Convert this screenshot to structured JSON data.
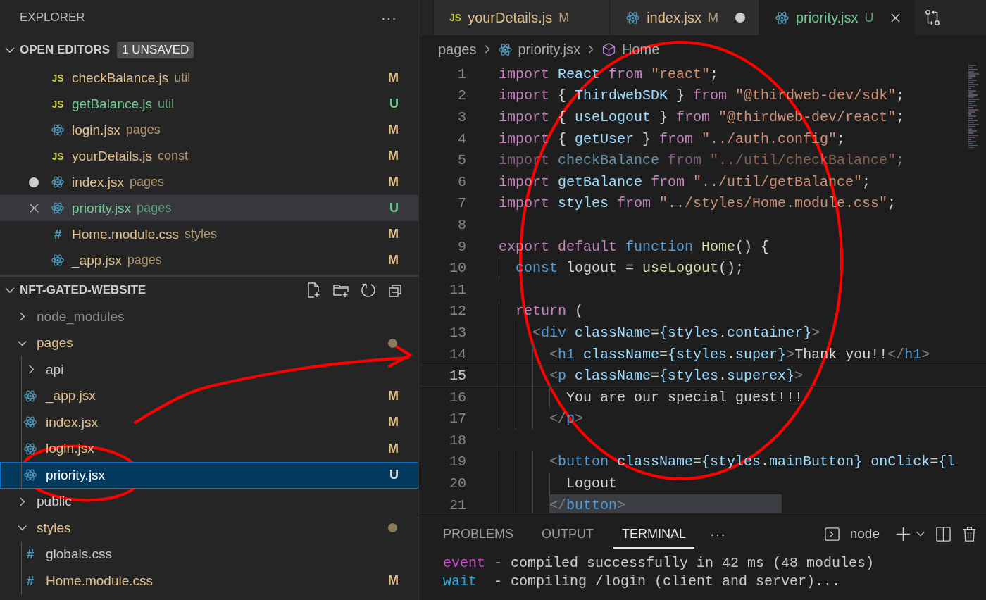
{
  "explorer": {
    "title": "EXPLORER",
    "more": "···"
  },
  "open_editors": {
    "title": "OPEN EDITORS",
    "badge": "1 UNSAVED",
    "expanded": true,
    "items": [
      {
        "kind": "js",
        "glyph": "JS",
        "name": "checkBalance.js",
        "folder": "util",
        "color": "#e2c08d",
        "status": "M",
        "unsaved": false,
        "hovered": false,
        "selected": false
      },
      {
        "kind": "js",
        "glyph": "JS",
        "name": "getBalance.js",
        "folder": "util",
        "color": "#73c991",
        "status": "U",
        "unsaved": false,
        "hovered": false,
        "selected": false
      },
      {
        "kind": "react",
        "name": "login.jsx",
        "folder": "pages",
        "color": "#e2c08d",
        "status": "M",
        "unsaved": false,
        "hovered": false,
        "selected": false
      },
      {
        "kind": "js",
        "glyph": "JS",
        "name": "yourDetails.js",
        "folder": "const",
        "color": "#e2c08d",
        "status": "M",
        "unsaved": false,
        "hovered": false,
        "selected": false
      },
      {
        "kind": "react",
        "name": "index.jsx",
        "folder": "pages",
        "color": "#e2c08d",
        "status": "M",
        "unsaved": true,
        "hovered": false,
        "selected": false
      },
      {
        "kind": "react",
        "name": "priority.jsx",
        "folder": "pages",
        "color": "#73c991",
        "status": "U",
        "unsaved": false,
        "hovered": true,
        "selected": true
      },
      {
        "kind": "css",
        "glyph": "#",
        "name": "Home.module.css",
        "folder": "styles",
        "color": "#e2c08d",
        "status": "M",
        "unsaved": false,
        "hovered": false,
        "selected": false
      },
      {
        "kind": "react",
        "name": "_app.jsx",
        "folder": "pages",
        "color": "#e2c08d",
        "status": "M",
        "unsaved": false,
        "hovered": false,
        "selected": false
      }
    ]
  },
  "project": {
    "title": "NFT-GATED-WEBSITE",
    "expanded": true,
    "tree": [
      {
        "name": "node_modules",
        "kind": "folder",
        "expanded": false,
        "color": "#8c8c8c",
        "changed": false,
        "selected": false
      },
      {
        "name": "pages",
        "kind": "folder",
        "expanded": true,
        "color": "#e2c08d",
        "changed": true,
        "selected": false,
        "children": [
          {
            "name": "api",
            "kind": "folder",
            "expanded": false,
            "color": "#cccccc",
            "changed": false,
            "selected": false
          },
          {
            "name": "_app.jsx",
            "kind": "react",
            "color": "#e2c08d",
            "status": "M",
            "selected": false
          },
          {
            "name": "index.jsx",
            "kind": "react",
            "color": "#e2c08d",
            "status": "M",
            "selected": false
          },
          {
            "name": "login.jsx",
            "kind": "react",
            "color": "#e2c08d",
            "status": "M",
            "selected": false
          },
          {
            "name": "priority.jsx",
            "kind": "react",
            "status": "U",
            "selected": true
          }
        ]
      },
      {
        "name": "public",
        "kind": "folder",
        "expanded": false,
        "color": "#cccccc",
        "changed": false,
        "selected": false
      },
      {
        "name": "styles",
        "kind": "folder",
        "expanded": true,
        "color": "#e2c08d",
        "changed": true,
        "selected": false,
        "children": [
          {
            "name": "globals.css",
            "kind": "css",
            "glyph": "#",
            "color": "#cccccc",
            "selected": false
          },
          {
            "name": "Home.module.css",
            "kind": "css",
            "glyph": "#",
            "color": "#e2c08d",
            "status": "M",
            "selected": false
          }
        ]
      }
    ]
  },
  "tabs": [
    {
      "kind": "js",
      "glyph": "JS",
      "name": "yourDetails.js",
      "color": "#e2c08d",
      "status": "M",
      "unsaved": false,
      "selected": false
    },
    {
      "kind": "react",
      "name": "index.jsx",
      "color": "#e2c08d",
      "status": "M",
      "unsaved": true,
      "selected": false
    },
    {
      "kind": "react",
      "name": "priority.jsx",
      "color": "#73c991",
      "status": "U",
      "unsaved": false,
      "selected": true
    }
  ],
  "breadcrumb": [
    {
      "label": "pages",
      "kind": "folder"
    },
    {
      "label": "priority.jsx",
      "kind": "react"
    },
    {
      "label": "Home",
      "kind": "symbol"
    }
  ],
  "code": [
    {
      "number": "1",
      "tokens": [
        {
          "kind": "kw",
          "text": "import"
        },
        {
          "kind": "var",
          "text": " React "
        },
        {
          "kind": "kw",
          "text": "from "
        },
        {
          "kind": "str",
          "text": "\"react\""
        },
        {
          "kind": "punc",
          "text": ";"
        }
      ]
    },
    {
      "number": "2",
      "tokens": [
        {
          "kind": "kw",
          "text": "import "
        },
        {
          "kind": "punc",
          "text": "{ "
        },
        {
          "kind": "var",
          "text": "ThirdwebSDK"
        },
        {
          "kind": "punc",
          "text": " } "
        },
        {
          "kind": "kw",
          "text": "from "
        },
        {
          "kind": "str",
          "text": "\"@thirdweb-dev/sdk\""
        },
        {
          "kind": "punc",
          "text": ";"
        }
      ]
    },
    {
      "number": "3",
      "tokens": [
        {
          "kind": "kw",
          "text": "import "
        },
        {
          "kind": "punc",
          "text": "{ "
        },
        {
          "kind": "var",
          "text": "useLogout"
        },
        {
          "kind": "punc",
          "text": " } "
        },
        {
          "kind": "kw",
          "text": "from "
        },
        {
          "kind": "str",
          "text": "\"@thirdweb-dev/react\""
        },
        {
          "kind": "punc",
          "text": ";"
        }
      ]
    },
    {
      "number": "4",
      "tokens": [
        {
          "kind": "kw",
          "text": "import "
        },
        {
          "kind": "punc",
          "text": "{ "
        },
        {
          "kind": "var",
          "text": "getUser"
        },
        {
          "kind": "punc",
          "text": " } "
        },
        {
          "kind": "kw",
          "text": "from "
        },
        {
          "kind": "str",
          "text": "\"../auth.config\""
        },
        {
          "kind": "punc",
          "text": ";"
        }
      ]
    },
    {
      "number": "5",
      "faded": true,
      "tokens": [
        {
          "kind": "kw",
          "text": "import"
        },
        {
          "kind": "var",
          "text": " checkBalance "
        },
        {
          "kind": "kw",
          "text": "from "
        },
        {
          "kind": "str",
          "text": "\"../util/checkBalance\""
        },
        {
          "kind": "punc",
          "text": ";"
        }
      ]
    },
    {
      "number": "6",
      "tokens": [
        {
          "kind": "kw",
          "text": "import"
        },
        {
          "kind": "var",
          "text": " getBalance "
        },
        {
          "kind": "kw",
          "text": "from "
        },
        {
          "kind": "str",
          "text": "\"../util/getBalance\""
        },
        {
          "kind": "punc",
          "text": ";"
        }
      ]
    },
    {
      "number": "7",
      "tokens": [
        {
          "kind": "kw",
          "text": "import"
        },
        {
          "kind": "var",
          "text": " styles "
        },
        {
          "kind": "kw",
          "text": "from "
        },
        {
          "kind": "str",
          "text": "\"../styles/Home.module.css\""
        },
        {
          "kind": "punc",
          "text": ";"
        }
      ]
    },
    {
      "number": "8"
    },
    {
      "number": "9",
      "tokens": [
        {
          "kind": "kw",
          "text": "export default "
        },
        {
          "kind": "storage",
          "text": "function "
        },
        {
          "kind": "fn",
          "text": "Home"
        },
        {
          "kind": "punc",
          "text": "() {"
        }
      ]
    },
    {
      "number": "10",
      "tokens": [
        {
          "kind": "storage",
          "text": "  const "
        },
        {
          "kind": "punc",
          "text": "logout = "
        },
        {
          "kind": "fn",
          "text": "useLogout"
        },
        {
          "kind": "punc",
          "text": "();"
        }
      ]
    },
    {
      "number": "11"
    },
    {
      "number": "12",
      "tokens": [
        {
          "kind": "kw",
          "text": "  return "
        },
        {
          "kind": "punc",
          "text": "("
        }
      ]
    },
    {
      "number": "13",
      "tokens": [
        {
          "kind": "bracket",
          "text": "    <"
        },
        {
          "kind": "tag",
          "text": "div "
        },
        {
          "kind": "attr",
          "text": "className"
        },
        {
          "kind": "punc",
          "text": "="
        },
        {
          "kind": "var",
          "text": "{styles"
        },
        {
          "kind": "punc",
          "text": "."
        },
        {
          "kind": "var",
          "text": "container}"
        },
        {
          "kind": "bracket",
          "text": ">"
        }
      ]
    },
    {
      "number": "14",
      "tokens": [
        {
          "kind": "bracket",
          "text": "      <"
        },
        {
          "kind": "tag",
          "text": "h1 "
        },
        {
          "kind": "attr",
          "text": "className"
        },
        {
          "kind": "punc",
          "text": "="
        },
        {
          "kind": "var",
          "text": "{styles"
        },
        {
          "kind": "punc",
          "text": "."
        },
        {
          "kind": "var",
          "text": "super}"
        },
        {
          "kind": "bracket",
          "text": ">"
        },
        {
          "kind": "punc",
          "text": "Thank you!!"
        },
        {
          "kind": "bracket",
          "text": "</"
        },
        {
          "kind": "tag",
          "text": "h1"
        },
        {
          "kind": "bracket",
          "text": ">"
        }
      ]
    },
    {
      "number": "15",
      "current": true,
      "tokens": [
        {
          "kind": "bracket",
          "text": "      <"
        },
        {
          "kind": "tag",
          "text": "p "
        },
        {
          "kind": "attr",
          "text": "className"
        },
        {
          "kind": "punc",
          "text": "="
        },
        {
          "kind": "var",
          "text": "{styles"
        },
        {
          "kind": "punc",
          "text": "."
        },
        {
          "kind": "var",
          "text": "superex}"
        },
        {
          "kind": "bracket",
          "text": ">"
        }
      ]
    },
    {
      "number": "16",
      "tokens": [
        {
          "kind": "punc",
          "text": "        You are our special guest!!!"
        }
      ]
    },
    {
      "number": "17",
      "tokens": [
        {
          "kind": "bracket",
          "text": "      </"
        },
        {
          "kind": "tag",
          "text": "p"
        },
        {
          "kind": "bracket",
          "text": ">"
        }
      ]
    },
    {
      "number": "18"
    },
    {
      "number": "19",
      "tokens": [
        {
          "kind": "bracket",
          "text": "      <"
        },
        {
          "kind": "tag",
          "text": "button "
        },
        {
          "kind": "attr",
          "text": "className"
        },
        {
          "kind": "punc",
          "text": "="
        },
        {
          "kind": "var",
          "text": "{styles"
        },
        {
          "kind": "punc",
          "text": "."
        },
        {
          "kind": "var",
          "text": "mainButton} "
        },
        {
          "kind": "attr",
          "text": "onClick"
        },
        {
          "kind": "punc",
          "text": "="
        },
        {
          "kind": "var",
          "text": "{l"
        }
      ]
    },
    {
      "number": "20",
      "tokens": [
        {
          "kind": "punc",
          "text": "        Logout"
        }
      ]
    },
    {
      "number": "21",
      "selected": true,
      "tokens": [
        {
          "kind": "bracket",
          "text": "      </"
        },
        {
          "kind": "tag",
          "text": "button"
        },
        {
          "kind": "bracket",
          "text": ">"
        }
      ]
    }
  ],
  "panel": {
    "tabs": [
      {
        "label": "PROBLEMS",
        "selected": false
      },
      {
        "label": "OUTPUT",
        "selected": false
      },
      {
        "label": "TERMINAL",
        "selected": true
      }
    ],
    "more": "···",
    "shell": "node",
    "terminal": [
      {
        "kind": "event",
        "prefix": "event",
        "text": " - compiled successfully in 42 ms (48 modules)"
      },
      {
        "kind": "wait",
        "prefix": "wait",
        "text": "  - compiling /login (client and server)..."
      }
    ]
  }
}
